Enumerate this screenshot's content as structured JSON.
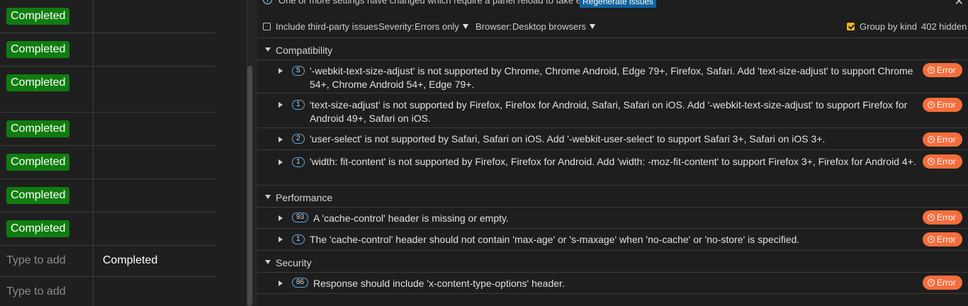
{
  "left_table": {
    "rows": [
      {
        "c1": "Completed"
      },
      {
        "c1": "Completed"
      },
      {
        "c1": "Completed"
      },
      {
        "c1": "Completed"
      },
      {
        "c1": "Completed"
      },
      {
        "c1": "Completed"
      },
      {
        "c1": "Completed"
      }
    ],
    "add_rows": [
      {
        "placeholder": "Type to add",
        "c2": "Completed"
      },
      {
        "placeholder": "Type to add",
        "c2": ""
      }
    ],
    "status_color": "#107c10"
  },
  "banner": {
    "info_icon": "info-icon",
    "message": "One or more settings have changed which require a panel reload to take effect.",
    "regenerate_label": "Regenerate issues",
    "close_icon": "close-icon"
  },
  "toolbar": {
    "include_third_party_label": "Include third-party issues",
    "include_third_party_checked": false,
    "severity_label": "Severity:",
    "severity_value": "Errors only",
    "browser_label": "Browser:",
    "browser_value": "Desktop browsers",
    "group_by_kind_label": "Group by kind",
    "group_by_kind_checked": true,
    "hidden_count": "402 hidden"
  },
  "groups": [
    {
      "title": "Compatibility",
      "issues": [
        {
          "count": "5",
          "text": "'-webkit-text-size-adjust' is not supported by Chrome, Chrome Android, Edge 79+, Firefox, Safari. Add 'text-size-adjust' to support Chrome 54+, Chrome Android 54+, Edge 79+.",
          "severity": "Error"
        },
        {
          "count": "1",
          "text": "'text-size-adjust' is not supported by Firefox, Firefox for Android, Safari, Safari on iOS. Add '-webkit-text-size-adjust' to support Firefox for Android 49+, Safari on iOS.",
          "severity": "Error"
        },
        {
          "count": "2",
          "text": "'user-select' is not supported by Safari, Safari on iOS. Add '-webkit-user-select' to support Safari 3+, Safari on iOS 3+.",
          "severity": "Error"
        },
        {
          "count": "1",
          "text": "'width: fit-content' is not supported by Firefox, Firefox for Android. Add 'width: -moz-fit-content' to support Firefox 3+, Firefox for Android 4+.",
          "severity": "Error"
        }
      ]
    },
    {
      "title": "Performance",
      "issues": [
        {
          "count": "93",
          "text": "A 'cache-control' header is missing or empty.",
          "severity": "Error"
        },
        {
          "count": "1",
          "text": "The 'cache-control' header should not contain 'max-age' or 's-maxage' when 'no-cache' or 'no-store' is specified.",
          "severity": "Error"
        }
      ]
    },
    {
      "title": "Security",
      "issues": [
        {
          "count": "86",
          "text": "Response should include 'x-content-type-options' header.",
          "severity": "Error"
        }
      ]
    }
  ],
  "colors": {
    "error_badge": "#f46e3d",
    "accent": "#0e639c",
    "checkbox_on": "#f0b429"
  }
}
